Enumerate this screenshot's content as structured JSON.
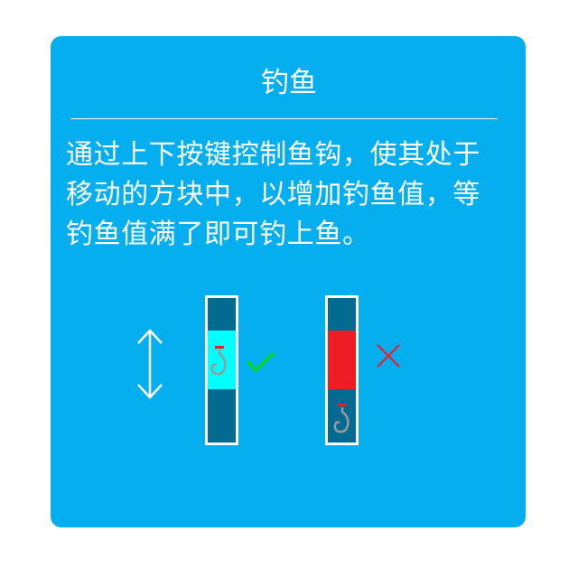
{
  "title": "钓鱼",
  "description_lines": [
    "通过上下按键控制鱼钩，使其处于",
    "移动的方块中，以增加钓鱼值，等",
    "钓鱼值满了即可钓上鱼。"
  ],
  "colors": {
    "card": "#05AEEE",
    "track": "#036A92",
    "zone_good": "#00FFFF",
    "zone_bad": "#EE1C25",
    "check": "#00E000",
    "cross": "#EE1C25",
    "hook": "#9A9A9A"
  },
  "icons": [
    "up-down-arrow-icon",
    "hook-icon",
    "check-icon",
    "cross-icon"
  ]
}
